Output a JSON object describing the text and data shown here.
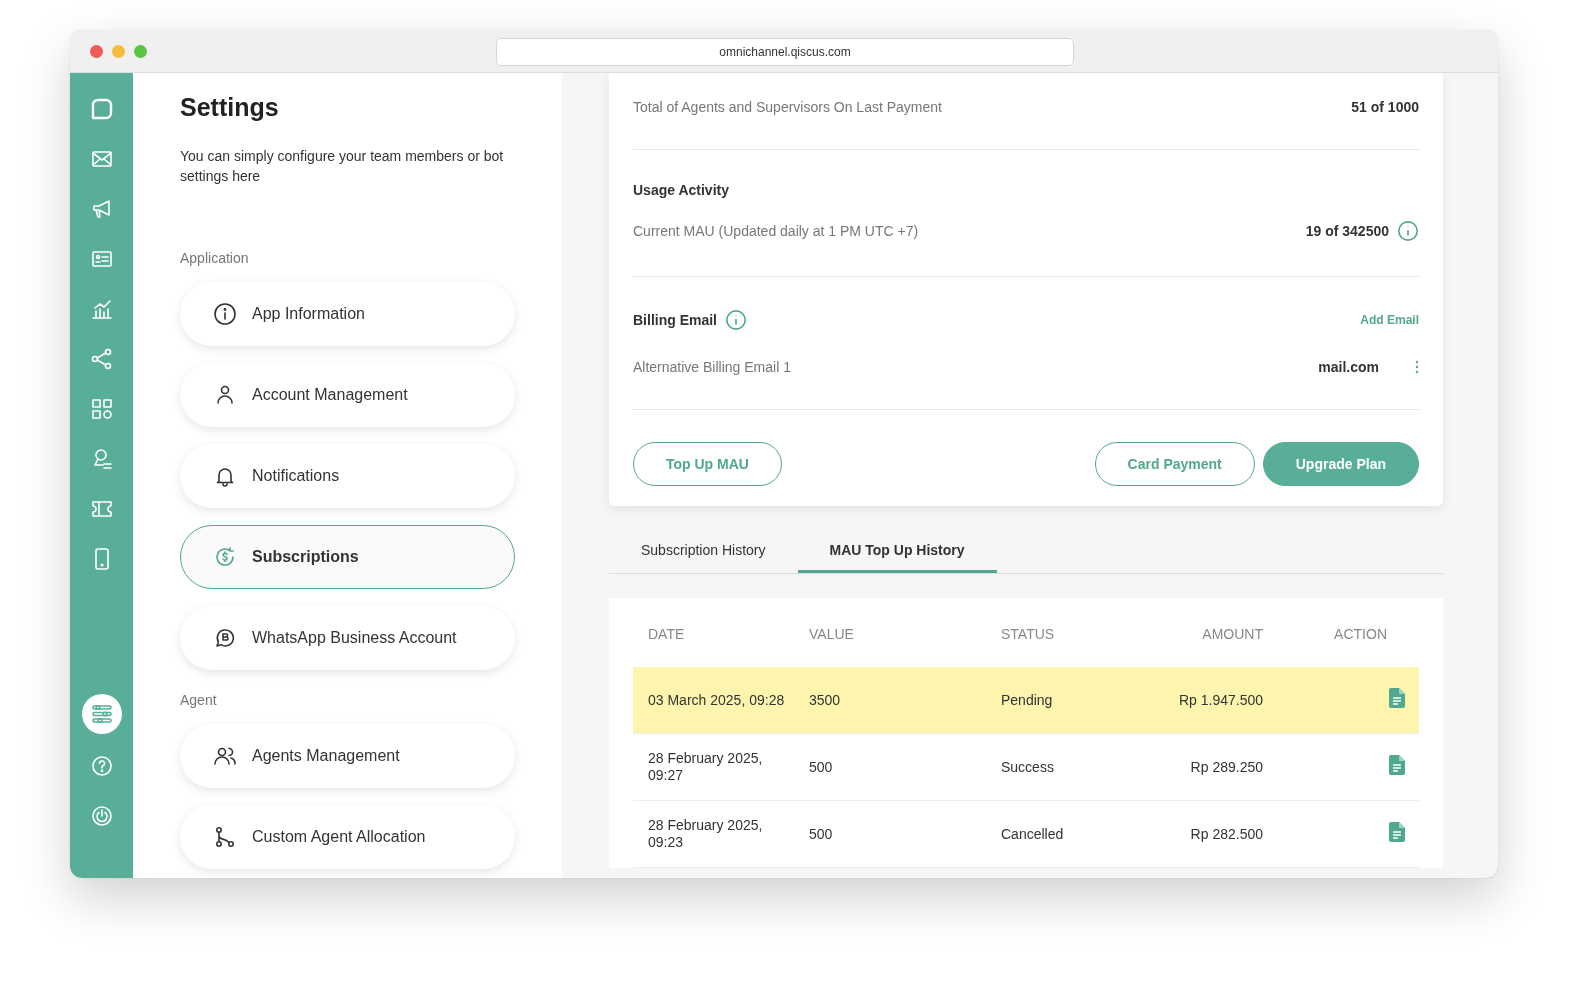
{
  "browser": {
    "url": "omnichannel.qiscus.com"
  },
  "nav": [
    {
      "selected": false
    },
    {
      "selected": false
    },
    {
      "selected": false
    },
    {
      "selected": false
    },
    {
      "selected": false
    },
    {
      "selected": false
    },
    {
      "selected": false
    },
    {
      "selected": false
    },
    {
      "selected": false
    },
    {
      "selected": false
    }
  ],
  "nav_bottom": [
    {
      "selected": true
    },
    {
      "selected": false
    },
    {
      "selected": false
    }
  ],
  "settings": {
    "title": "Settings",
    "description": "You can simply configure your team members or bot settings here",
    "groups": [
      {
        "label": "Application",
        "items": [
          {
            "label": "App Information",
            "selected": false
          },
          {
            "label": "Account Management",
            "selected": false
          },
          {
            "label": "Notifications",
            "selected": false
          },
          {
            "label": "Subscriptions",
            "selected": true
          },
          {
            "label": "WhatsApp Business Account",
            "selected": false
          }
        ]
      },
      {
        "label": "Agent",
        "items": [
          {
            "label": "Agents Management",
            "selected": false
          },
          {
            "label": "Custom Agent Allocation",
            "selected": false
          }
        ]
      }
    ]
  },
  "subscription": {
    "agents_label": "Total of Agents and Supervisors On Last Payment",
    "agents_value": "51 of 1000",
    "usage_title": "Usage Activity",
    "mau_label": "Current MAU (Updated daily at 1 PM UTC +7)",
    "mau_value": "19 of 342500",
    "billing_title": "Billing Email",
    "add_email": "Add Email",
    "alt_email_label": "Alternative Billing Email 1",
    "alt_email_value": "mail.com",
    "buttons": [
      {
        "label": "Top Up MAU",
        "kind": "outline"
      },
      {
        "label": "Card Payment",
        "kind": "outline"
      },
      {
        "label": "Upgrade Plan",
        "kind": "primary"
      }
    ]
  },
  "tabs": [
    {
      "label": "Subscription History",
      "selected": false
    },
    {
      "label": "MAU Top Up History",
      "selected": true
    }
  ],
  "table": {
    "columns": [
      "DATE",
      "VALUE",
      "STATUS",
      "AMOUNT",
      "ACTION"
    ],
    "rows": [
      {
        "date": "03 March 2025, 09:28",
        "value": "3500",
        "status": "Pending",
        "amount": "Rp 1.947.500",
        "highlighted": true
      },
      {
        "date": "28 February 2025, 09:27",
        "value": "500",
        "status": "Success",
        "amount": "Rp 289.250",
        "highlighted": false
      },
      {
        "date": "28 February 2025, 09:23",
        "value": "500",
        "status": "Cancelled",
        "amount": "Rp 282.500",
        "highlighted": false
      }
    ]
  }
}
